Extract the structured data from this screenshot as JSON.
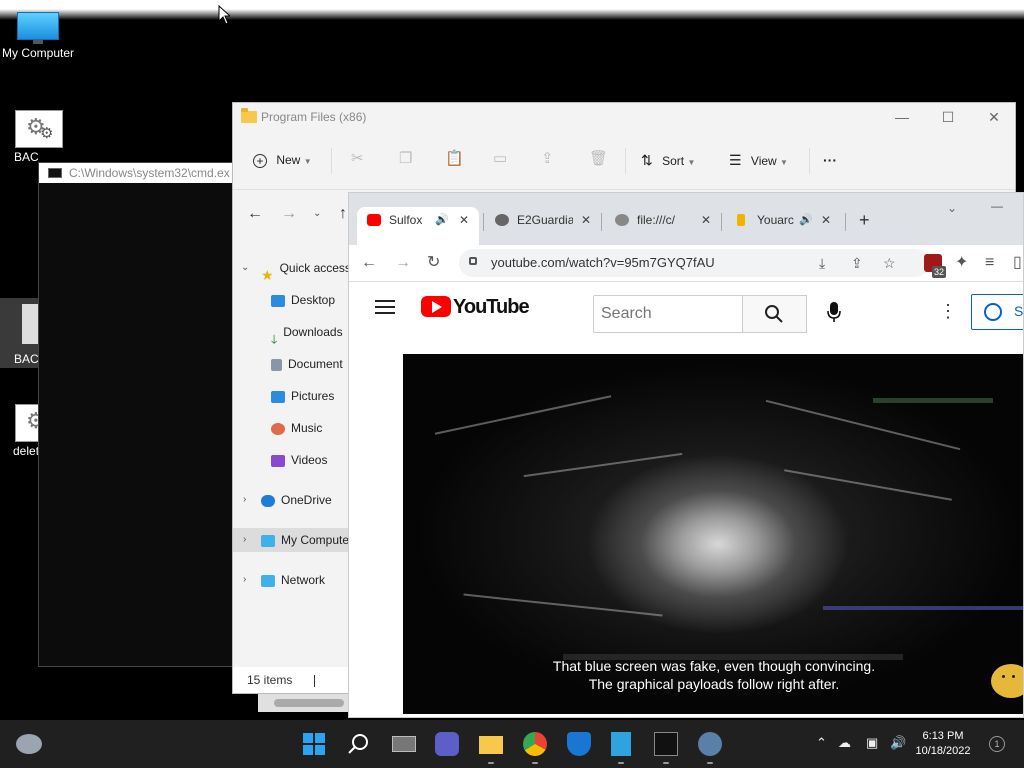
{
  "desktop": {
    "icons": [
      {
        "label": "My Computer"
      },
      {
        "label": "BAC"
      },
      {
        "label": "BAC"
      },
      {
        "label": "delet"
      }
    ]
  },
  "cmd": {
    "title": "C:\\Windows\\system32\\cmd.ex"
  },
  "explorer": {
    "title": "Program Files (x86)",
    "toolbar": {
      "new_label": "New",
      "sort_label": "Sort",
      "view_label": "View",
      "more_label": "···"
    },
    "nav": {
      "quick_access": "Quick access",
      "items": [
        "Desktop",
        "Downloads",
        "Document",
        "Pictures",
        "Music",
        "Videos"
      ],
      "onedrive": "OneDrive",
      "my_computer": "My Compute",
      "network": "Network"
    },
    "status": "15 items"
  },
  "chrome": {
    "tabs": [
      {
        "title": "Sulfox"
      },
      {
        "title": "E2Guardia"
      },
      {
        "title": "file:///c/"
      },
      {
        "title": "Youarc"
      }
    ],
    "new_tab": "+",
    "url": "youtube.com/watch?v=95m7GYQ7fAU",
    "extension_badge": "32"
  },
  "youtube": {
    "logo_text": "YouTube",
    "search_placeholder": "Search",
    "signin_label": "S",
    "caption_line1": "That blue screen was fake, even though convincing.",
    "caption_line2": "The graphical payloads follow right after."
  },
  "taskbar": {
    "time": "6:13 PM",
    "date": "10/18/2022",
    "notification_count": "1"
  },
  "colors": {
    "yt_red": "#ff0000",
    "win_blue": "#0078d4",
    "taskbar_bg": "#202020"
  }
}
